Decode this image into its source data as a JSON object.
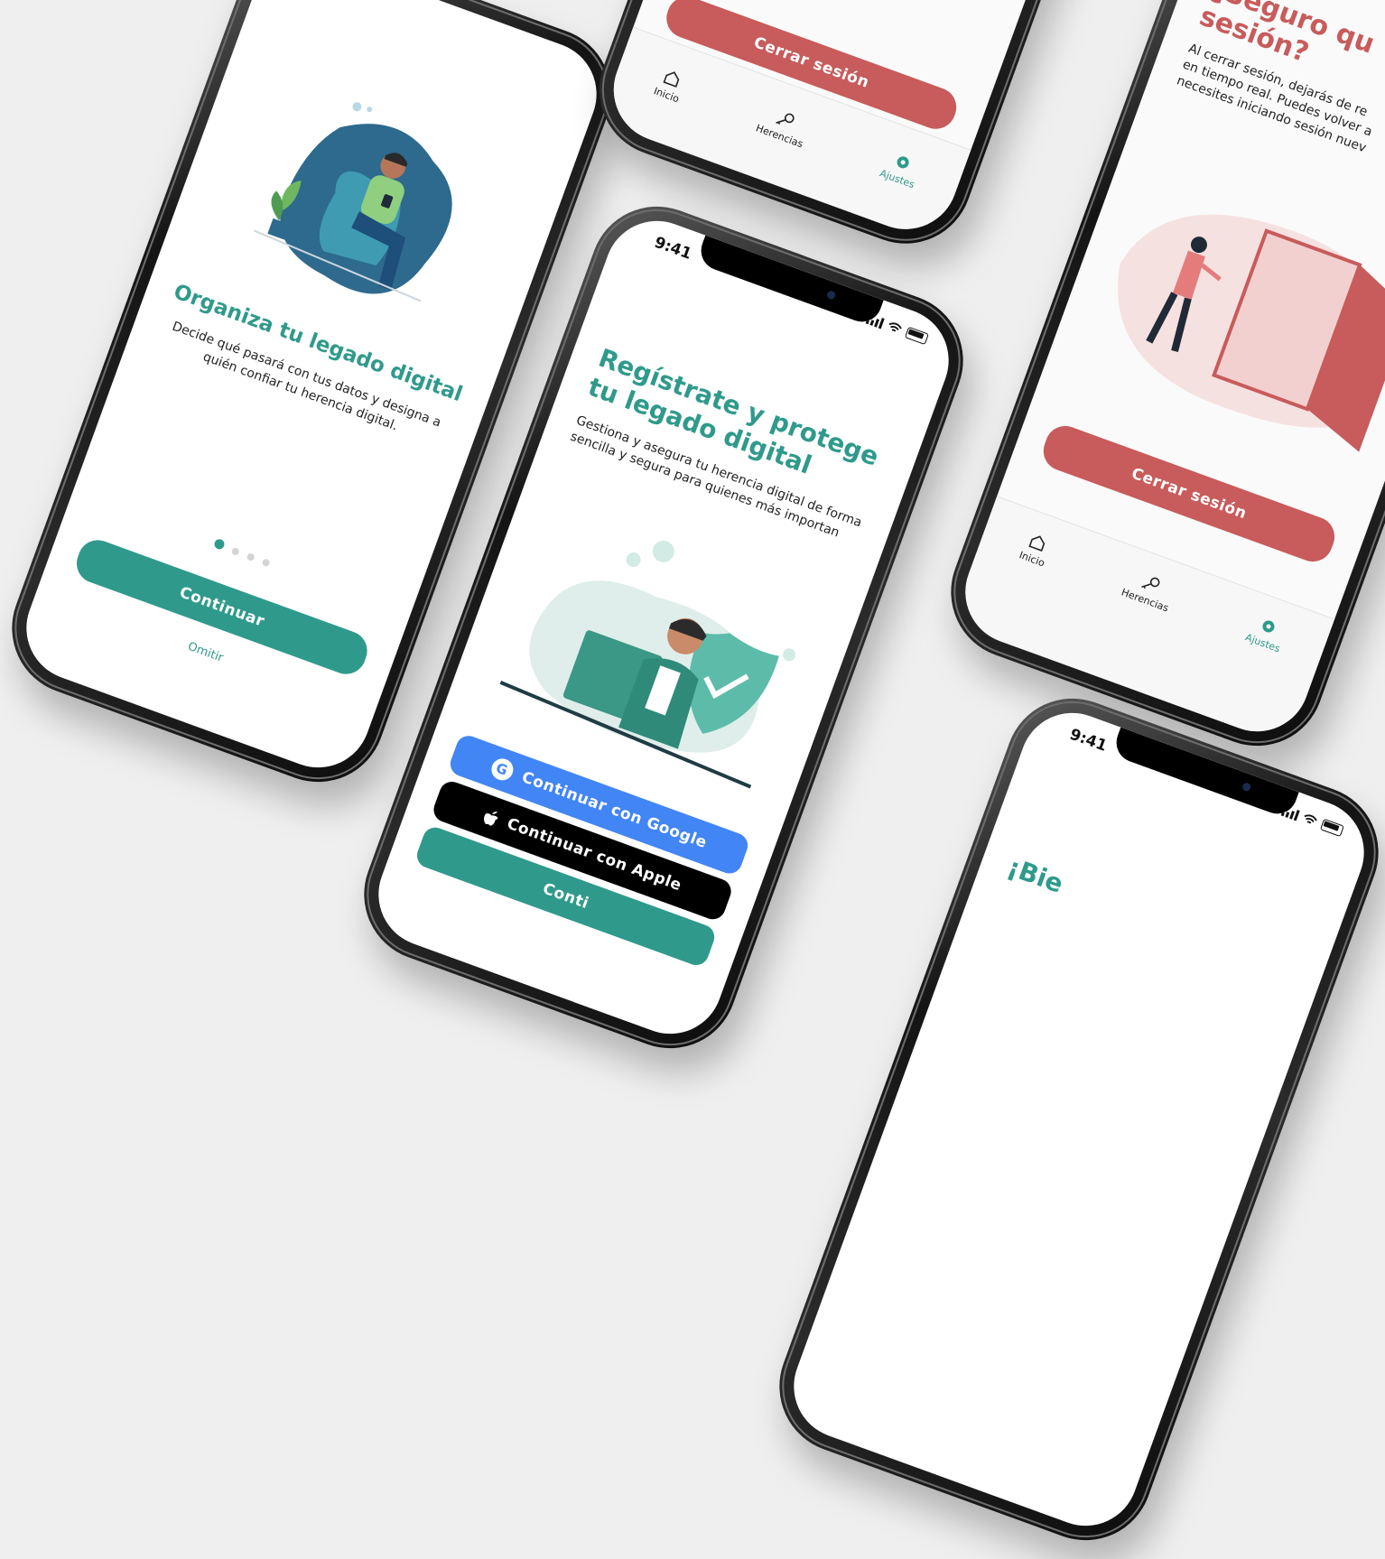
{
  "colors": {
    "teal": "#2f9a8b",
    "red": "#c85b5b",
    "google_blue": "#4285f4",
    "black": "#000000",
    "background": "#efefef"
  },
  "onboarding": {
    "title": "Organiza tu legado digital",
    "description": "Decide qué pasará con tus datos y designa a quién confiar tu herencia digital.",
    "pager": {
      "active_page": 1,
      "total_pages": 4
    },
    "continue_label": "Continuar",
    "skip_label": "Omitir"
  },
  "register": {
    "time": "9:41",
    "title": "Regístrate y protege tu legado digital",
    "description": "Gestiona y asegura tu herencia digital de forma sencilla y segura para quienes más importan",
    "google_label": "Continuar con Google",
    "apple_label": "Continuar con Apple",
    "third_label": "Conti"
  },
  "settings_top": {
    "logout_label": "Cerrar sesión",
    "tabs": [
      {
        "label": "Inicio",
        "icon": "home-icon"
      },
      {
        "label": "Herencias",
        "icon": "key-icon"
      },
      {
        "label": "Ajustes",
        "icon": "gear-icon",
        "active": true
      }
    ]
  },
  "logout_confirm": {
    "title": "¿Seguro qu sesión?",
    "title_line1": "¿Seguro qu",
    "title_line2": "sesión?",
    "description_lines": [
      "Al cerrar sesión, dejarás de re",
      "en tiempo real. Puedes volver a",
      "necesites iniciando sesión nuev"
    ],
    "logout_label": "Cerrar sesión",
    "tabs": [
      {
        "label": "Inicio",
        "icon": "home-icon"
      },
      {
        "label": "Herencias",
        "icon": "key-icon"
      },
      {
        "label": "Ajustes",
        "icon": "gear-icon",
        "active": true
      }
    ]
  },
  "welcome": {
    "time": "9:41",
    "title_partial": "¡Bie"
  }
}
